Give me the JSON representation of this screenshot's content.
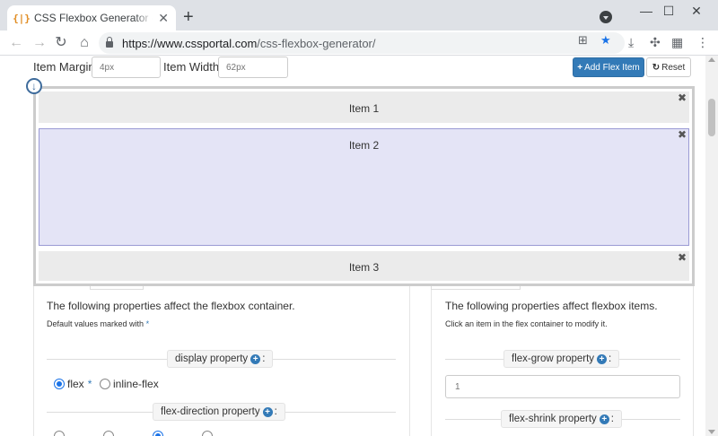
{
  "browser": {
    "tab_title": "CSS Flexbox Generator - CSS Portal",
    "favicon_text": "{|}",
    "url_host": "https://www.cssportal.com",
    "url_path": "/css-flexbox-generator/"
  },
  "controls": {
    "item_margin_label": "Item Margin",
    "item_margin_value": "4px",
    "item_width_label": "Item Width",
    "item_width_value": "62px",
    "add_button": "Add Flex Item",
    "reset_button": "Reset"
  },
  "flex_items": [
    {
      "label": "Item 1"
    },
    {
      "label": "Item 2"
    },
    {
      "label": "Item 3"
    }
  ],
  "container_panel": {
    "description": "The following properties affect the flexbox container.",
    "note": "Default values marked with",
    "display_property_label": "display property",
    "display_options": [
      "flex",
      "inline-flex"
    ],
    "flex_direction_label": "flex-direction property"
  },
  "items_panel": {
    "description": "The following properties affect flexbox items.",
    "note": "Click an item in the flex container to modify it.",
    "flex_grow_label": "flex-grow property",
    "flex_grow_value": "1",
    "flex_shrink_label": "flex-shrink property"
  },
  "colors": {
    "accent": "#337ab7",
    "selected_item_bg": "#e4e4f6",
    "item_bg": "#ebebeb"
  }
}
